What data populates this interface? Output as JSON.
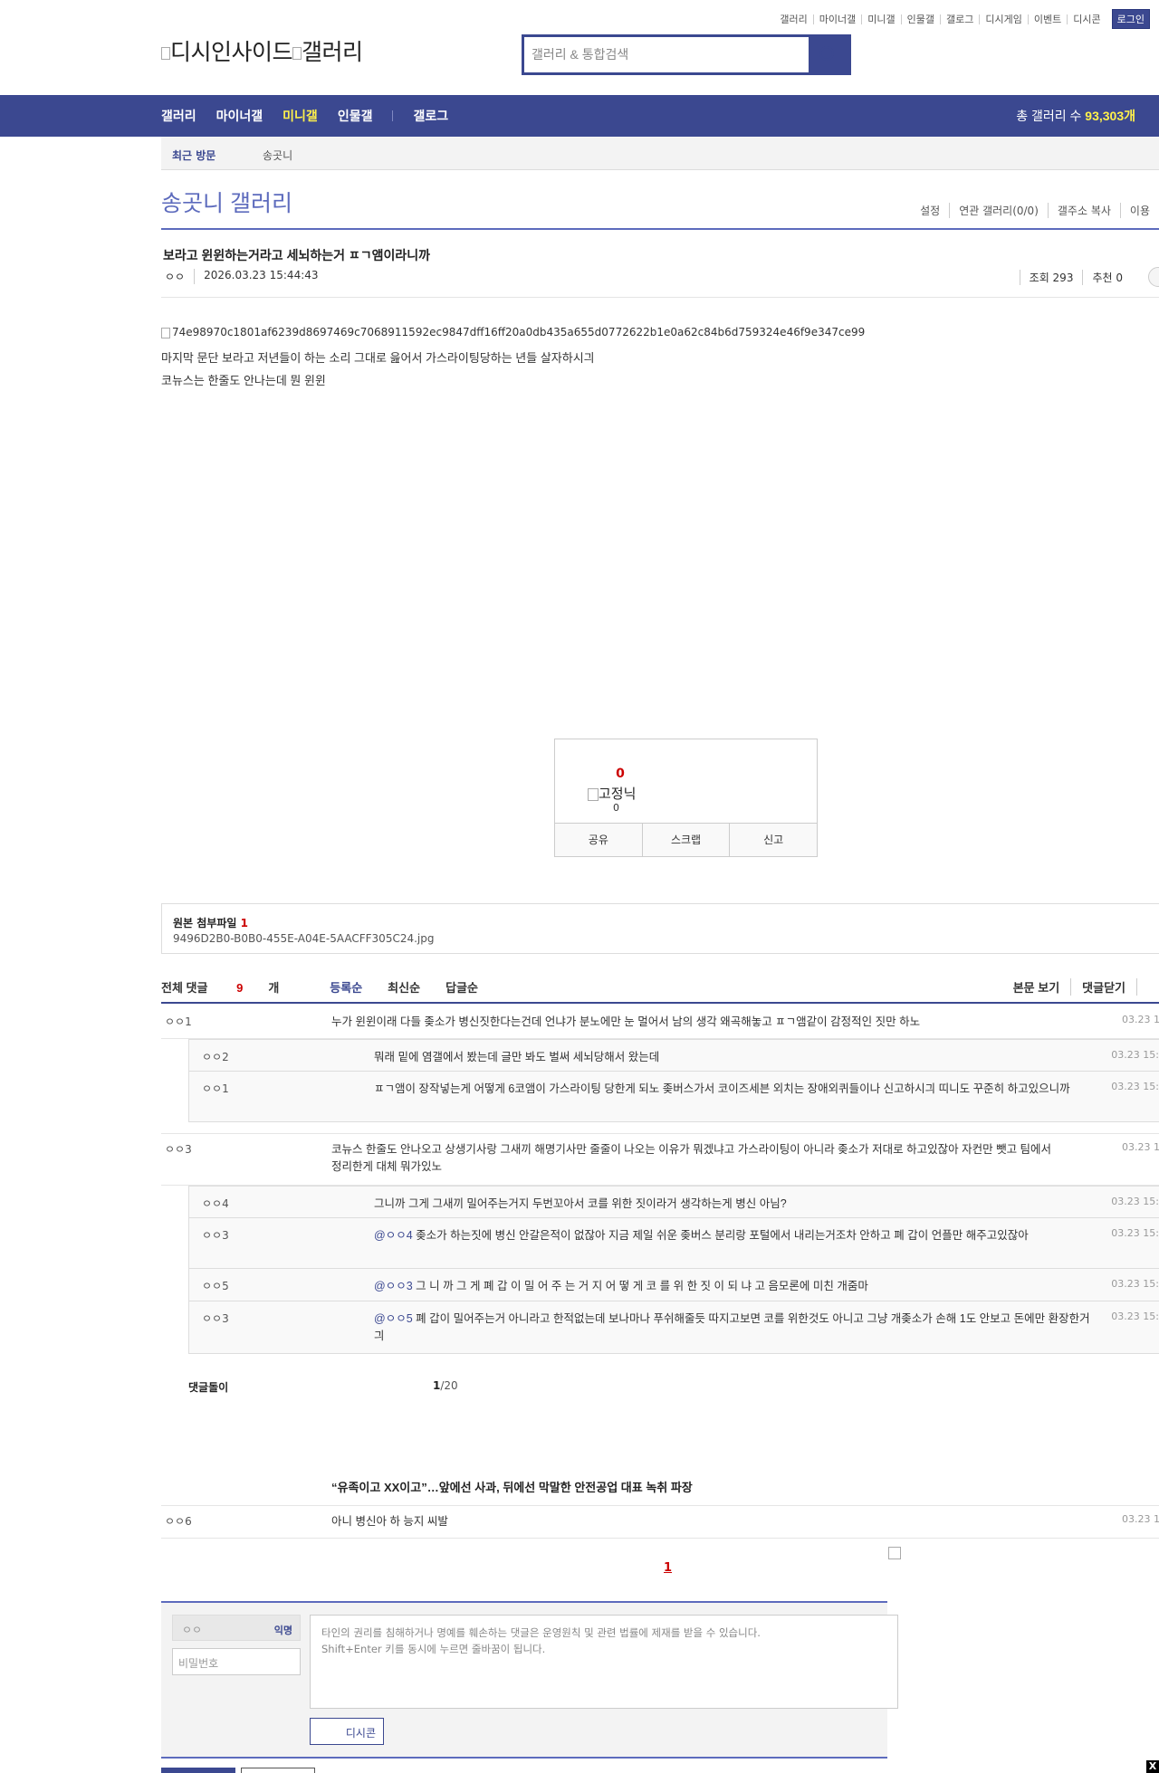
{
  "top_links": [
    "갤러리",
    "마이너갤",
    "미니갤",
    "인물갤",
    "갤로그",
    "디시게임",
    "이벤트",
    "디시콘"
  ],
  "login_label": "로그인",
  "logo_alt": "디시인사이드",
  "logo_alt2": "갤러리",
  "search": {
    "placeholder": "갤러리 & 통합검색"
  },
  "nav": {
    "items": [
      "갤러리",
      "마이너갤",
      "미니갤",
      "인물갤",
      "갤로그"
    ],
    "selected": "미니갤",
    "total_label": "총 갤러리 수 ",
    "total_value": "93,303개"
  },
  "recent": {
    "label": "최근 방문",
    "value": "송곳니"
  },
  "gallery": {
    "title": "송곳니 갤러리",
    "menu": [
      "설정",
      "연관 갤러리(0/0)",
      "갤주소 복사",
      "이용"
    ]
  },
  "post": {
    "title": "보라고 윈윈하는거라고 세뇌하는거 ㅍㄱ앰이라니까",
    "author": "ㅇㅇ",
    "date": "2026.03.23 15:44:43",
    "views": "조회 293",
    "recommend": "추천 0",
    "image_alt": "74e98970c1801af6239d8697469c7068911592ec9847dff16ff20a0db435a655d0772622b1e0a62c84b6d759324e46f9e347ce99",
    "lines": [
      "마지막 문단 보라고 저년들이 하는 소리 그대로 읊어서 가스라이팅당하는 년들 살자하시긔",
      "코뉴스는 한줄도 안나는데 뭔 윈윈"
    ]
  },
  "recommend_box": {
    "count": "0",
    "fix_label": "고정닉",
    "fix_count": "0",
    "buttons": [
      "공유",
      "스크랩",
      "신고"
    ]
  },
  "attach": {
    "label": "원본 첨부파일 ",
    "count": "1",
    "filename": "9496D2B0-B0B0-455E-A04E-5AACFF305C24.jpg"
  },
  "comments_bar": {
    "total_prefix": "전체 댓글 ",
    "total_count": "9",
    "total_suffix": "개",
    "sorts": [
      "등록순",
      "최신순",
      "답글순"
    ],
    "selected_sort": "등록순",
    "right": [
      "본문 보기",
      "댓글닫기"
    ]
  },
  "comments": [
    {
      "nick": "ㅇㅇ1",
      "text": "누가 윈윈이래 다들 좆소가 병신짓한다는건데 언냐가 분노에만 눈 멀어서 남의 생각 왜곡해놓고 ㅍㄱ앰같이 감정적인 짓만 하노",
      "date": "03.23 15"
    },
    {
      "nick": "ㅇㅇ2",
      "text": "뭐래 밑에 염갤에서 봤는데 글만 봐도 벌써 세뇌당해서 왔는데",
      "date": "03.23 15:4"
    },
    {
      "nick": "ㅇㅇ1",
      "text": "ㅍㄱ앰이 장작넣는게 어떻게 6코앰이 가스라이팅 당한게 되노 좆버스가서 코이즈세븐 외치는 장애외퀴들이나 신고하시긔 띠니도 꾸준히 하고있으니까",
      "date": "03.23 15:4"
    },
    {
      "nick": "ㅇㅇ3",
      "text": "코뉴스 한줄도 안나오고 상생기사랑 그새끼 해명기사만 줄줄이 나오는 이유가 뭐겠냐고 가스라이팅이 아니라 좆소가 저대로 하고있잖아 자컨만 뺏고 팀에서 정리한게 대체 뭐가있노",
      "date": "03.23 15"
    },
    {
      "nick": "ㅇㅇ4",
      "text": "그니까 그게 그새끼 밀어주는거지 두번꼬아서 코를 위한 짓이라거 생각하는게 병신 아님?",
      "date": "03.23 15:4"
    },
    {
      "nick": "ㅇㅇ3",
      "at": "@ㅇㅇ4",
      "text": " 좆소가 하는짓에 병신 안갈은적이 없잖아 지금 제일 쉬운 좆버스 분리랑 포털에서 내리는거조차 안하고 폐 갑이 언플만 해주고있잖아",
      "date": "03.23 15:5"
    },
    {
      "nick": "ㅇㅇ5",
      "at": "@ㅇㅇ3",
      "text": " 그 니 까 그 게 폐 갑 이 밀 어 주 는 거 지 어 떻 게 코 를 위 한 짓 이 되 냐 고 음모론에 미친 개줌마",
      "date": "03.23 15:5"
    },
    {
      "nick": "ㅇㅇ3",
      "at": "@ㅇㅇ5",
      "text": " 폐 갑이 밀어주는거 아니라고 한적없는데 보나마나 푸쉬해줄듯 따지고보면 코를 위한것도 아니고 그냥 개좆소가 손해 1도 안보고 돈에만 환장한거긔",
      "date": "03.23 15:5"
    }
  ],
  "dlrow": {
    "label": "댓글돌이",
    "page": "1",
    "of": "/20"
  },
  "ad_title": "“유족이고 XX이고”…앞에선 사과, 뒤에선 막말한 안전공업 대표 녹취 파장",
  "last_comment": {
    "nick": "ㅇㅇ6",
    "text": "아니 병신아 하 능지 씨발",
    "date": "03.23 16"
  },
  "pager": "1",
  "write": {
    "name": "ㅇㅇ",
    "anon": "익명",
    "password_placeholder": "비밀번호",
    "textarea_line1": "타인의 권리를 침해하거나 명예를 훼손하는 댓글은 운영원칙 및 관련 법률에 제재를 받을 수 있습니다.",
    "textarea_line2": "Shift+Enter 키를 동시에 누르면 줄바꿈이 됩니다.",
    "dccon": "디시콘"
  },
  "close_label": "X",
  "colors": {
    "brand": "#3b4890",
    "accent": "#5d6bbd",
    "highlight": "#fff14b",
    "alert": "#cc0000"
  }
}
